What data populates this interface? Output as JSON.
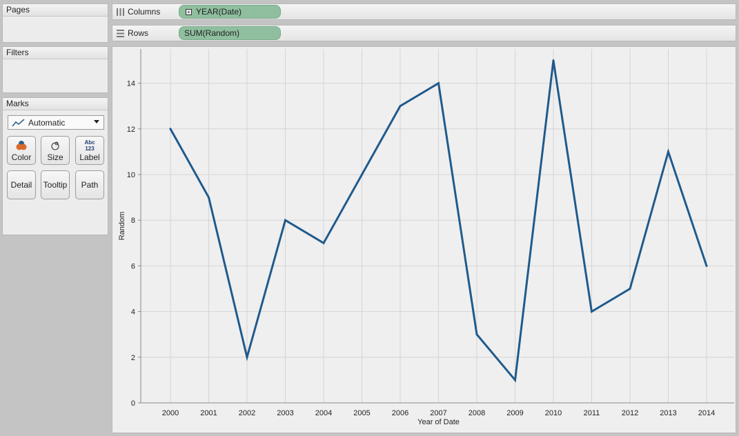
{
  "pages": {
    "title": "Pages"
  },
  "filters": {
    "title": "Filters"
  },
  "marks": {
    "title": "Marks",
    "mark_type": "Automatic",
    "buttons": {
      "color": "Color",
      "size": "Size",
      "label": "Label",
      "detail": "Detail",
      "tooltip": "Tooltip",
      "path": "Path"
    },
    "label_icon_top": "Abc",
    "label_icon_bottom": "123"
  },
  "shelves": {
    "columns": {
      "label": "Columns",
      "pill": "YEAR(Date)",
      "pill_expander": "+"
    },
    "rows": {
      "label": "Rows",
      "pill": "SUM(Random)"
    }
  },
  "colors": {
    "line": "#1f5a8c",
    "pill": "#8fbf9f",
    "color_icon_orange": "#d96b2a",
    "color_icon_blue": "#2d5f8f"
  },
  "chart_data": {
    "type": "line",
    "x": [
      "2000",
      "2001",
      "2002",
      "2003",
      "2004",
      "2005",
      "2006",
      "2007",
      "2008",
      "2009",
      "2010",
      "2011",
      "2012",
      "2013",
      "2014"
    ],
    "series": [
      {
        "values": [
          12,
          9,
          2,
          8,
          7,
          10,
          13,
          14,
          3,
          1,
          15,
          4,
          5,
          11,
          6
        ]
      }
    ],
    "xlabel": "Year of Date",
    "ylabel": "Random",
    "yticks": [
      0,
      2,
      4,
      6,
      8,
      10,
      12,
      14
    ],
    "ylim": [
      0,
      15.5
    ],
    "grid": true
  }
}
